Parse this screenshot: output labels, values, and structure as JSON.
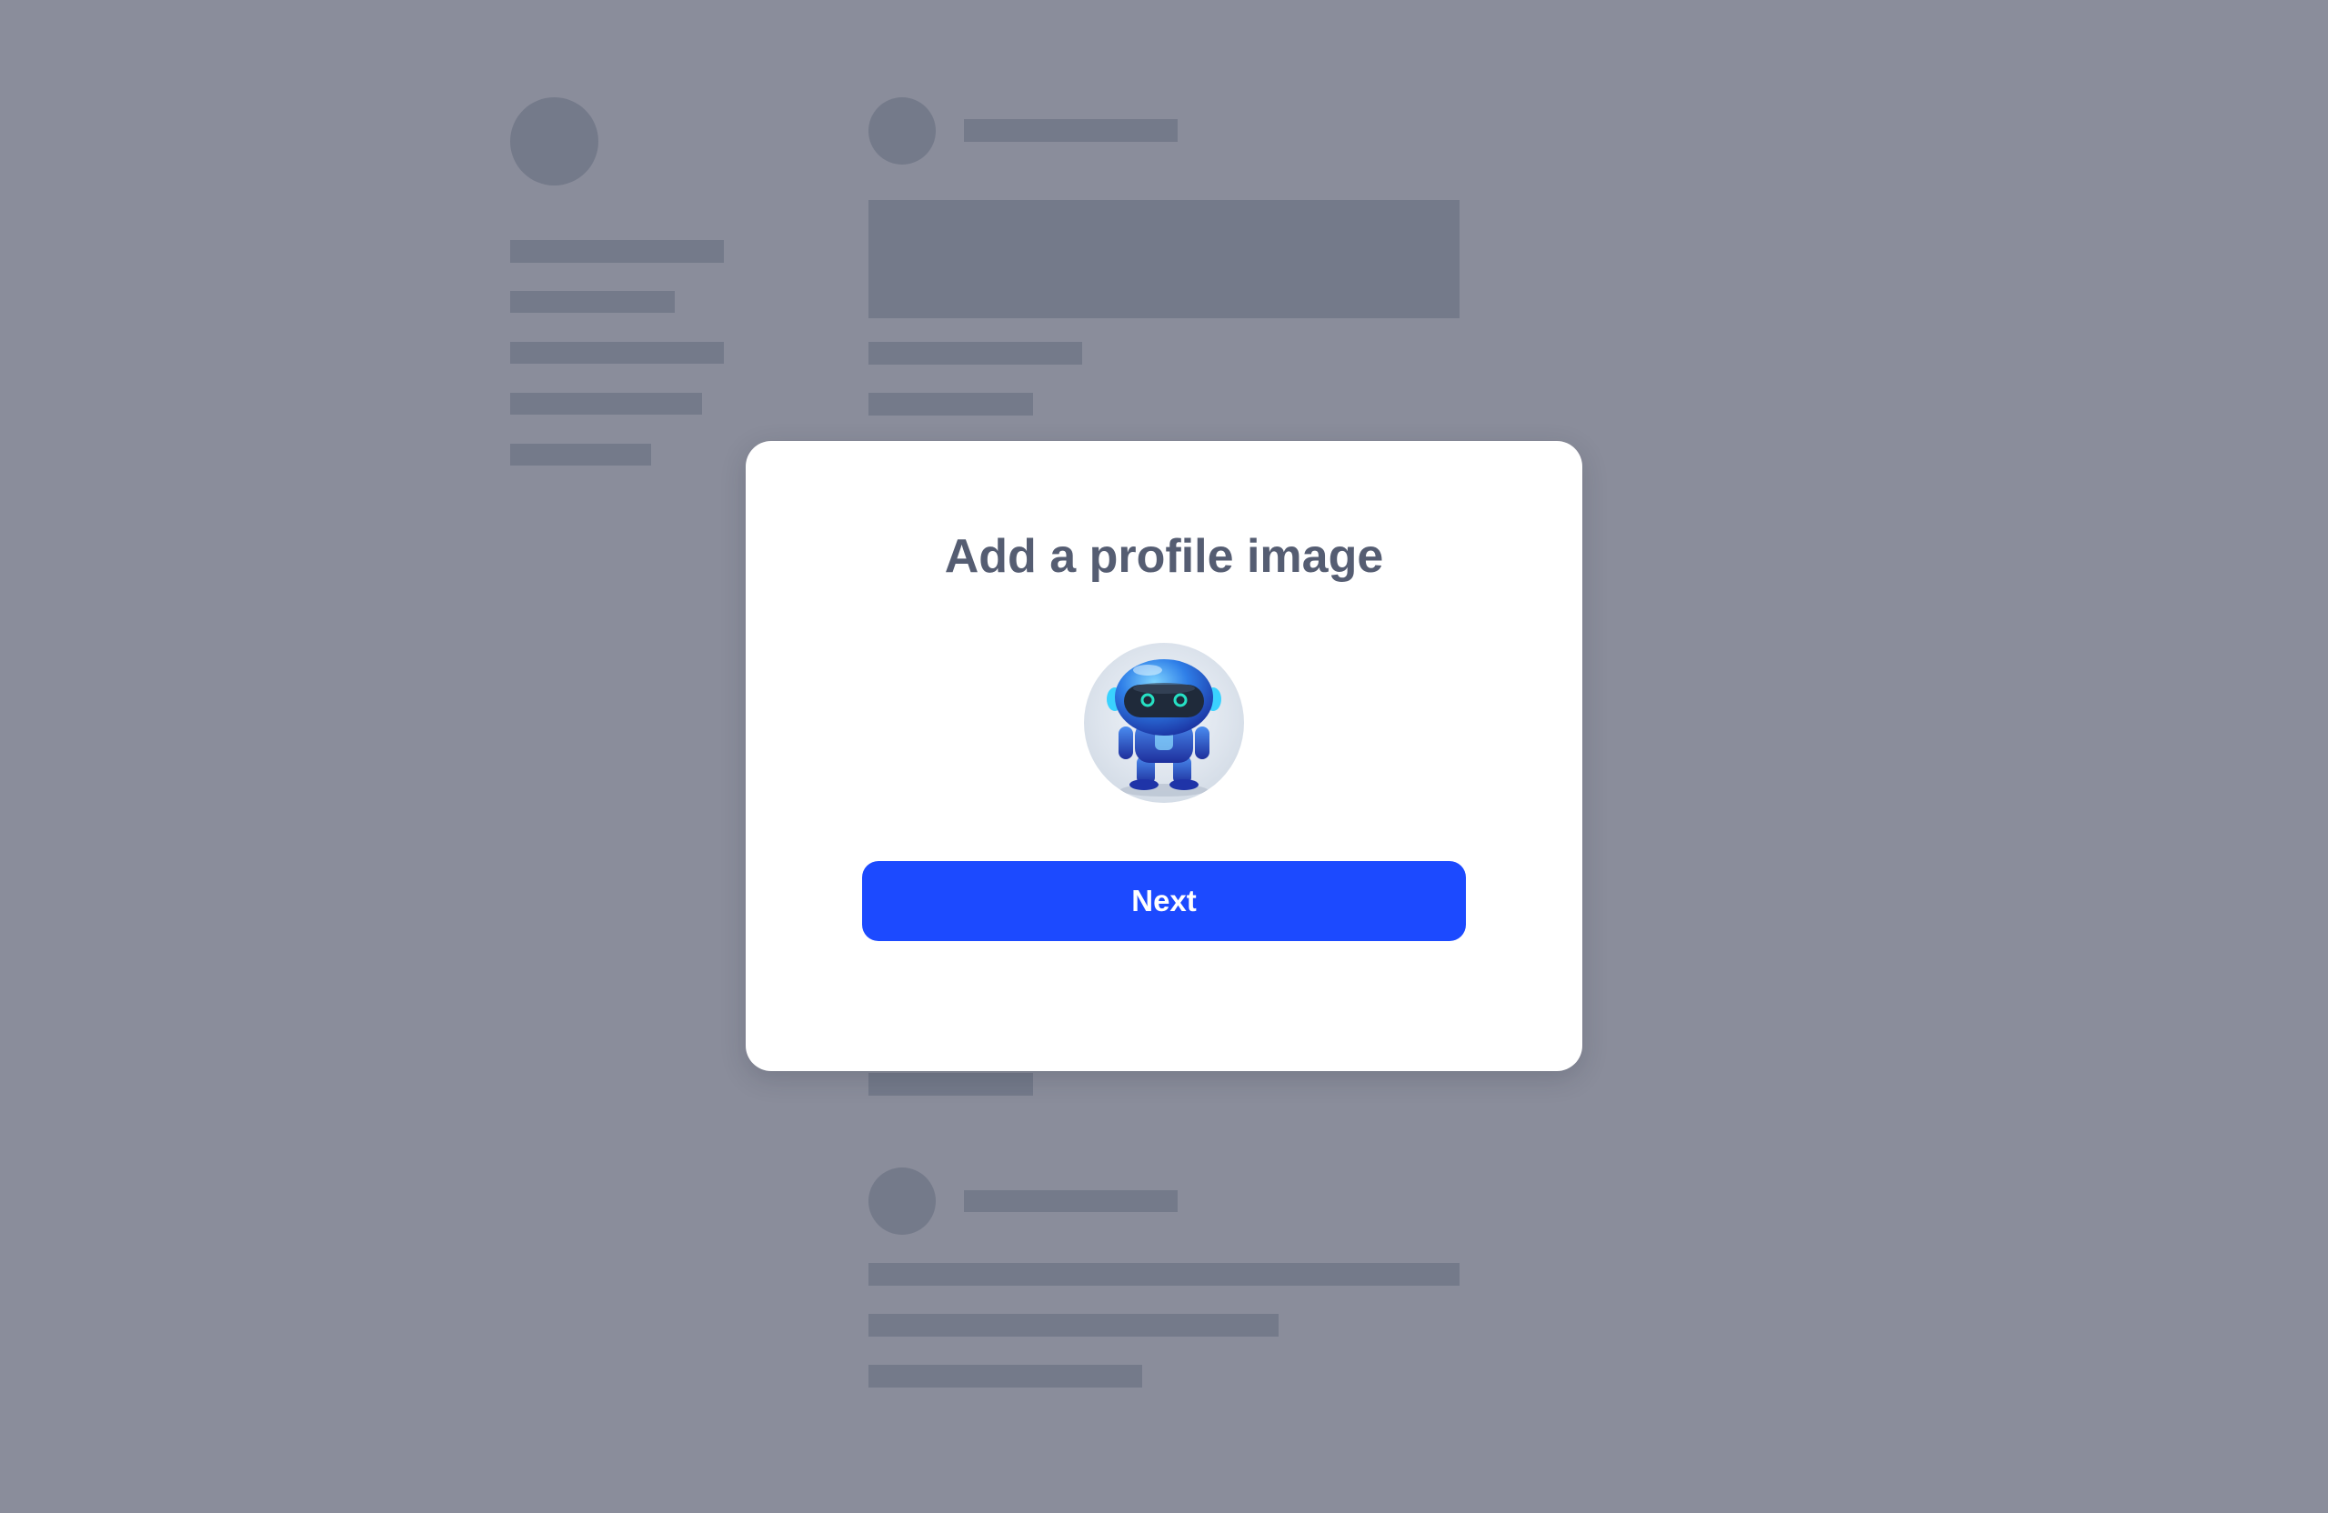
{
  "modal": {
    "title": "Add a profile image",
    "avatar_icon": "robot-avatar",
    "next_label": "Next"
  },
  "colors": {
    "overlay_background": "#8a8d9b",
    "skeleton": "#747a8a",
    "modal_background": "#ffffff",
    "title_text": "#555d72",
    "primary_button": "#1c4aff",
    "button_text": "#ffffff"
  }
}
